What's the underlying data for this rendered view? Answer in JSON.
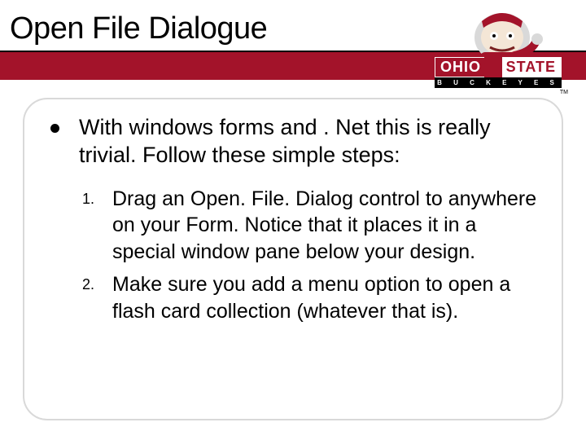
{
  "title": "Open File Dialogue",
  "logo": {
    "ohio": "OHIO",
    "state": "STATE",
    "sub": "B U C K E Y E S",
    "tm": "TM"
  },
  "intro": "With windows forms and . Net this is really trivial. Follow these simple steps:",
  "steps": [
    {
      "n": "1.",
      "text": "Drag an Open. File. Dialog control to anywhere on your Form. Notice that it places it in a special window pane below your design."
    },
    {
      "n": "2.",
      "text": "Make sure you add a menu option to open a flash card collection (whatever that is)."
    }
  ]
}
